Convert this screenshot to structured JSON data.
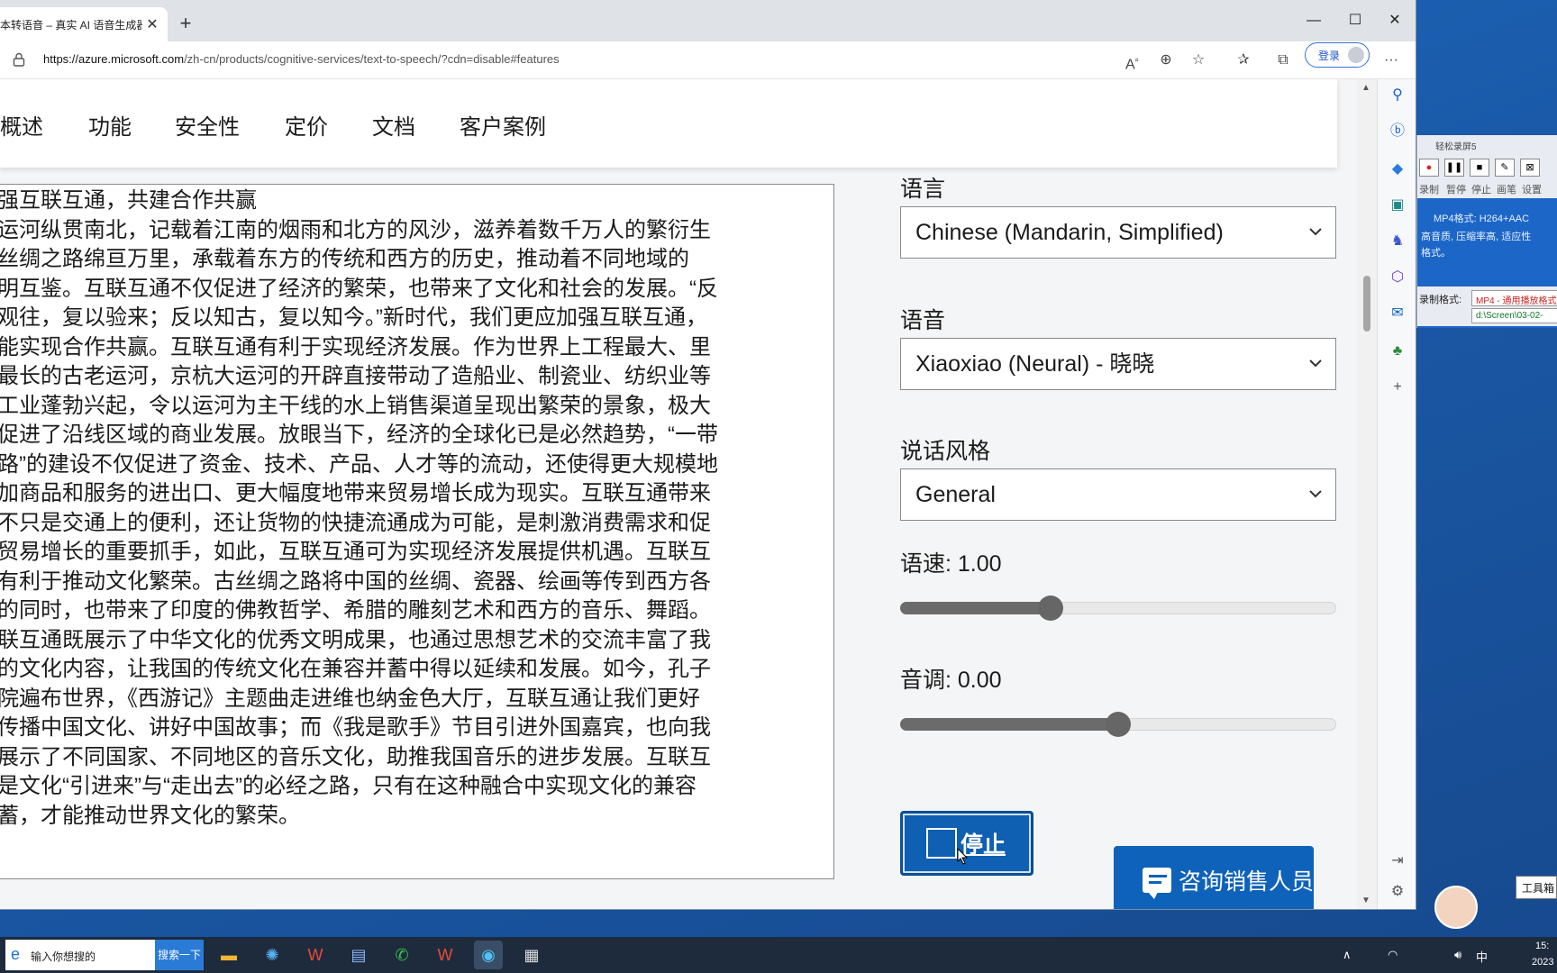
{
  "browser": {
    "tab_title": "本转语音 – 真实 AI 语音生成器",
    "tab_close": "✕",
    "new_tab": "+",
    "window_controls": {
      "minimize": "—",
      "maximize": "☐",
      "close": "✕"
    },
    "url_base": "https://azure.microsoft.com",
    "url_path": "/zh-cn/products/cognitive-services/text-to-speech/?cdn=disable#features",
    "login_label": "登录",
    "more_label": "···"
  },
  "nav": {
    "items": [
      "概述",
      "功能",
      "安全性",
      "定价",
      "文档",
      "客户案例"
    ]
  },
  "text_area": {
    "lines": [
      "强互联互通，共建合作共赢",
      "运河纵贯南北，记载着江南的烟雨和北方的风沙，滋养着数千万人的繁衍生",
      "丝绸之路绵亘万里，承载着东方的传统和西方的历史，推动着不同地域的",
      "明互鉴。互联互通不仅促进了经济的繁荣，也带来了文化和社会的发展。“反",
      "观往，复以验来；反以知古，复以知今。”新时代，我们更应加强互联互通，",
      "能实现合作共赢。互联互通有利于实现经济发展。作为世界上工程最大、里",
      "最长的古老运河，京杭大运河的开辟直接带动了造船业、制瓷业、纺织业等",
      "工业蓬勃兴起，令以运河为主干线的水上销售渠道呈现出繁荣的景象，极大",
      "促进了沿线区域的商业发展。放眼当下，经济的全球化已是必然趋势，“一带",
      "路”的建设不仅促进了资金、技术、产品、人才等的流动，还使得更大规模地",
      "加商品和服务的进出口、更大幅度地带来贸易增长成为现实。互联互通带来",
      "不只是交通上的便利，还让货物的快捷流通成为可能，是刺激消费需求和促",
      "贸易增长的重要抓手，如此，互联互通可为实现经济发展提供机遇。互联互",
      "有利于推动文化繁荣。古丝绸之路将中国的丝绸、瓷器、绘画等传到西方各",
      "的同时，也带来了印度的佛教哲学、希腊的雕刻艺术和西方的音乐、舞蹈。",
      "联互通既展示了中华文化的优秀文明成果，也通过思想艺术的交流丰富了我",
      "的文化内容，让我国的传统文化在兼容并蓄中得以延续和发展。如今，孔子",
      "院遍布世界，《西游记》主题曲走进维也纳金色大厅，互联互通让我们更好",
      "传播中国文化、讲好中国故事；而《我是歌手》节目引进外国嘉宾，也向我",
      "展示了不同国家、不同地区的音乐文化，助推我国音乐的进步发展。互联互",
      "是文化“引进来”与“走出去”的必经之路，只有在这种融合中实现文化的兼容",
      "蓄，才能推动世界文化的繁荣。"
    ]
  },
  "form": {
    "language_label": "语言",
    "language_value": "Chinese (Mandarin, Simplified)",
    "voice_label": "语音",
    "voice_value": "Xiaoxiao (Neural) - 晓晓",
    "style_label": "说话风格",
    "style_value": "General",
    "speed_label": "语速: 1.00",
    "speed_fraction": 0.345,
    "pitch_label": "音调: 0.00",
    "pitch_fraction": 0.5,
    "stop_label": "停止",
    "chevron": "⌄"
  },
  "sales_button": {
    "label": "咨询销售人员"
  },
  "recorder": {
    "title": "轻松录屏5",
    "buttons": [
      "●",
      "❚❚",
      "■",
      "✎",
      "⊠"
    ],
    "button_labels": [
      "录制",
      "暂停",
      "停止",
      "画笔",
      "设置"
    ],
    "info_line1": "MP4格式: H264+AAC",
    "info_line2": "高音质, 压缩率高, 适应性",
    "info_line3": "格式。",
    "format_label": "录制格式:",
    "format_value": "MP4 - 通用播放格式",
    "path_value": "d:\\Screen\\03-02-"
  },
  "tooltip": {
    "text": "工具箱"
  },
  "taskbar": {
    "search_placeholder": "输入你想搜的",
    "search_button": "搜索一下",
    "ime": "中",
    "time": "15:",
    "date": "2023"
  },
  "colors": {
    "accent": "#0f62b9",
    "stop_button": "#0f5fb3",
    "slider_fill": "#6b6b6b",
    "taskbar": "#1d2b3d"
  }
}
